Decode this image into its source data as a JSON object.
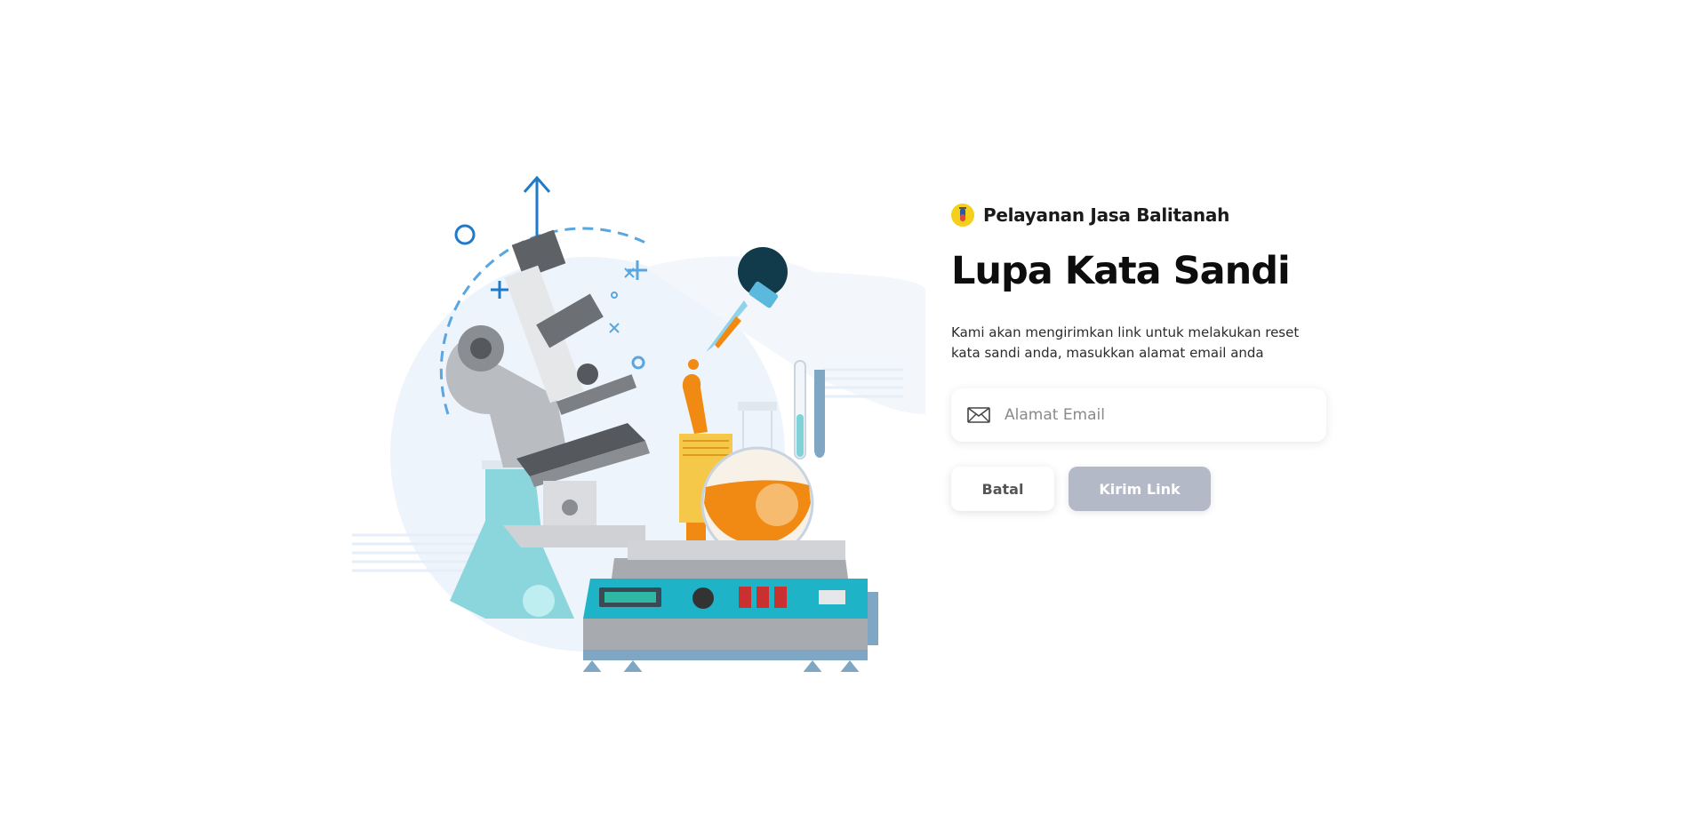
{
  "brand": {
    "name": "Pelayanan Jasa Balitanah",
    "logo_icon": "test-tube-icon",
    "logo_color": "#f5cf1a"
  },
  "page": {
    "title": "Lupa Kata Sandi",
    "description": "Kami akan mengirimkan link untuk melakukan reset kata sandi anda, masukkan alamat email anda"
  },
  "form": {
    "email_icon": "envelope-icon",
    "email_value": "",
    "email_placeholder": "Alamat Email",
    "cancel_label": "Batal",
    "submit_label": "Kirim Link"
  },
  "colors": {
    "submit_disabled": "#b3b9c7",
    "illustration_blue": "#1f7ac8",
    "illustration_orange": "#f08a12",
    "illustration_teal": "#1fb3c8"
  }
}
